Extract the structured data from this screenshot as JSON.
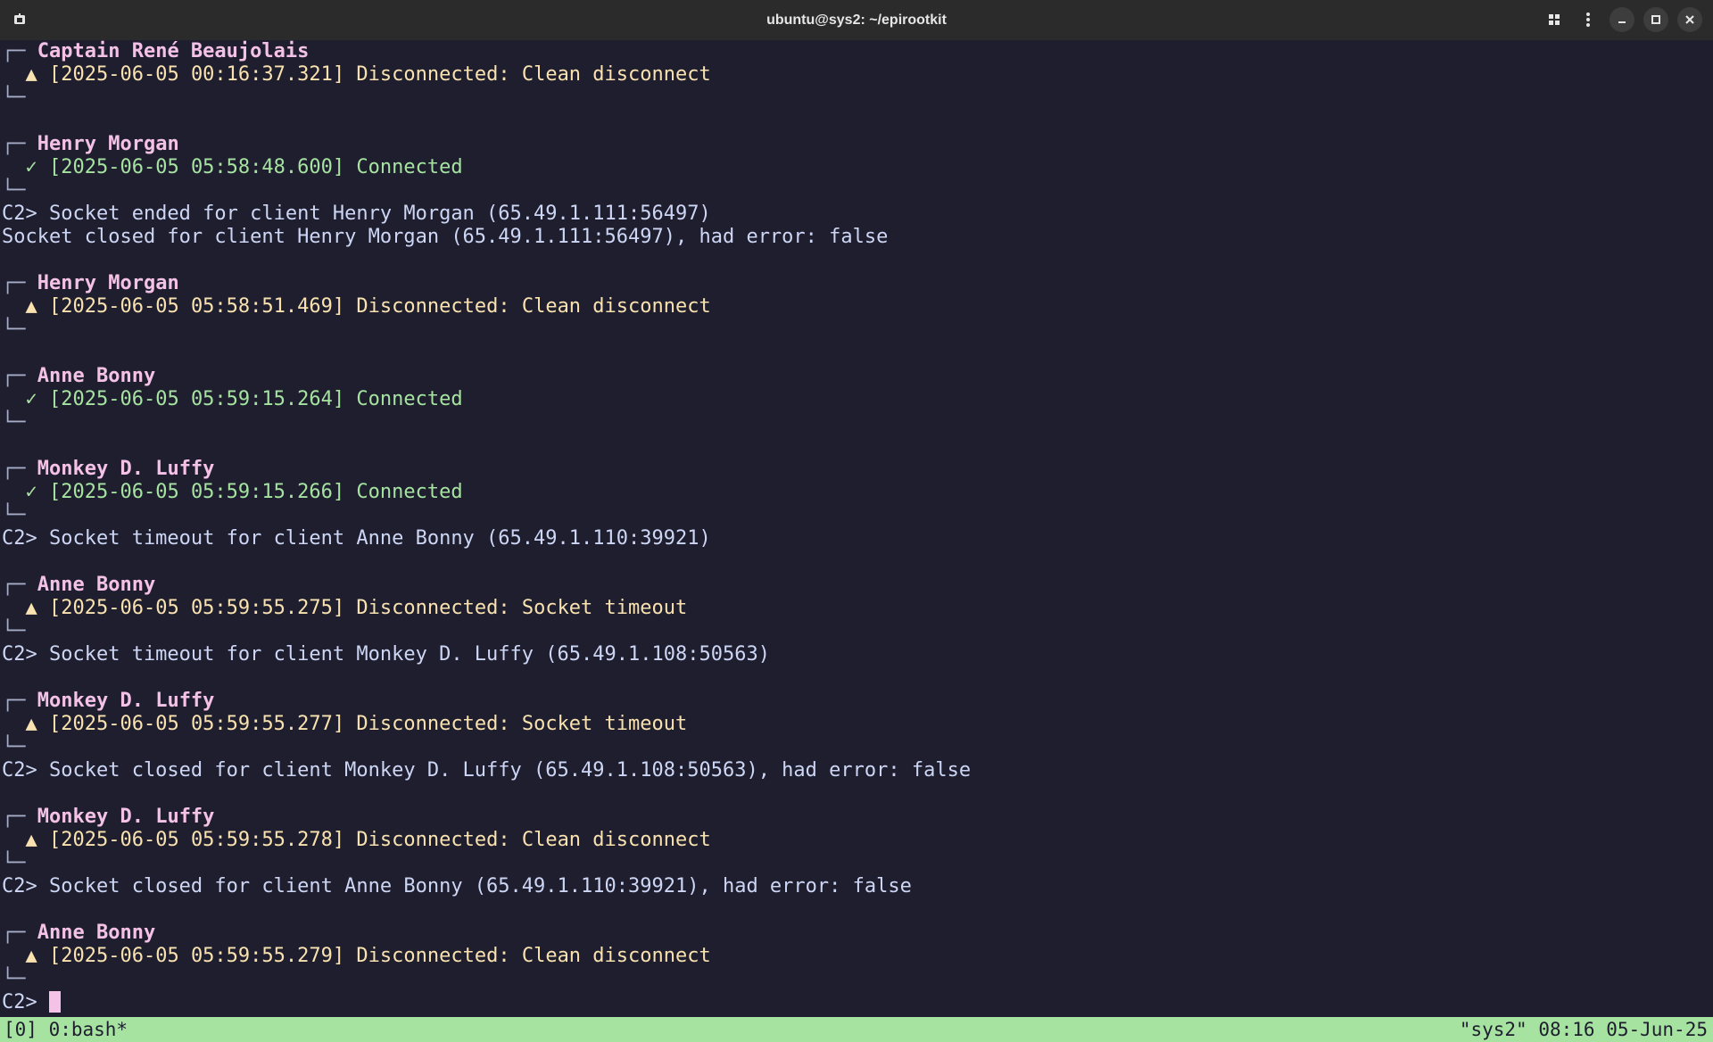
{
  "window": {
    "title": "ubuntu@sys2: ~/epirootkit",
    "controls": [
      "new-tab-icon",
      "menu-icon",
      "minimize-icon",
      "maximize-icon",
      "close-icon"
    ]
  },
  "colors": {
    "background": "#1e1e2e",
    "name": "#f5c2e7",
    "connected": "#a6e3a1",
    "warning": "#f9e2af",
    "statusbar": "#a6e3a1"
  },
  "glyphs": {
    "box_top": "┌─",
    "box_bottom": "└─",
    "check": "✓",
    "warn": "▲",
    "prompt": "C2>"
  },
  "log": [
    {
      "type": "event",
      "name": "Captain René Beaujolais",
      "status": "warn",
      "timestamp": "[2025-06-05 00:16:37.321]",
      "label": "Disconnected:",
      "detail": "Clean disconnect"
    },
    {
      "type": "blank"
    },
    {
      "type": "event",
      "name": "Henry Morgan",
      "status": "ok",
      "timestamp": "[2025-06-05 05:58:48.600]",
      "label": "Connected",
      "detail": ""
    },
    {
      "type": "prompt_msg",
      "text": "C2> Socket ended for client Henry Morgan (65.49.1.111:56497)"
    },
    {
      "type": "msg",
      "text": "Socket closed for client Henry Morgan (65.49.1.111:56497), had error: false"
    },
    {
      "type": "blank"
    },
    {
      "type": "event",
      "name": "Henry Morgan",
      "status": "warn",
      "timestamp": "[2025-06-05 05:58:51.469]",
      "label": "Disconnected:",
      "detail": "Clean disconnect"
    },
    {
      "type": "blank"
    },
    {
      "type": "event",
      "name": "Anne Bonny",
      "status": "ok",
      "timestamp": "[2025-06-05 05:59:15.264]",
      "label": "Connected",
      "detail": ""
    },
    {
      "type": "blank"
    },
    {
      "type": "event",
      "name": "Monkey D. Luffy",
      "status": "ok",
      "timestamp": "[2025-06-05 05:59:15.266]",
      "label": "Connected",
      "detail": ""
    },
    {
      "type": "prompt_msg",
      "text": "C2> Socket timeout for client Anne Bonny (65.49.1.110:39921)"
    },
    {
      "type": "blank"
    },
    {
      "type": "event",
      "name": "Anne Bonny",
      "status": "warn",
      "timestamp": "[2025-06-05 05:59:55.275]",
      "label": "Disconnected:",
      "detail": "Socket timeout"
    },
    {
      "type": "prompt_msg",
      "text": "C2> Socket timeout for client Monkey D. Luffy (65.49.1.108:50563)"
    },
    {
      "type": "blank"
    },
    {
      "type": "event",
      "name": "Monkey D. Luffy",
      "status": "warn",
      "timestamp": "[2025-06-05 05:59:55.277]",
      "label": "Disconnected:",
      "detail": "Socket timeout"
    },
    {
      "type": "prompt_msg",
      "text": "C2> Socket closed for client Monkey D. Luffy (65.49.1.108:50563), had error: false"
    },
    {
      "type": "blank"
    },
    {
      "type": "event",
      "name": "Monkey D. Luffy",
      "status": "warn",
      "timestamp": "[2025-06-05 05:59:55.278]",
      "label": "Disconnected:",
      "detail": "Clean disconnect"
    },
    {
      "type": "prompt_msg",
      "text": "C2> Socket closed for client Anne Bonny (65.49.1.110:39921), had error: false"
    },
    {
      "type": "blank"
    },
    {
      "type": "event",
      "name": "Anne Bonny",
      "status": "warn",
      "timestamp": "[2025-06-05 05:59:55.279]",
      "label": "Disconnected:",
      "detail": "Clean disconnect"
    },
    {
      "type": "input_prompt",
      "text": "C2> "
    }
  ],
  "statusbar": {
    "left": "[0] 0:bash*",
    "right": "\"sys2\" 08:16 05-Jun-25"
  }
}
